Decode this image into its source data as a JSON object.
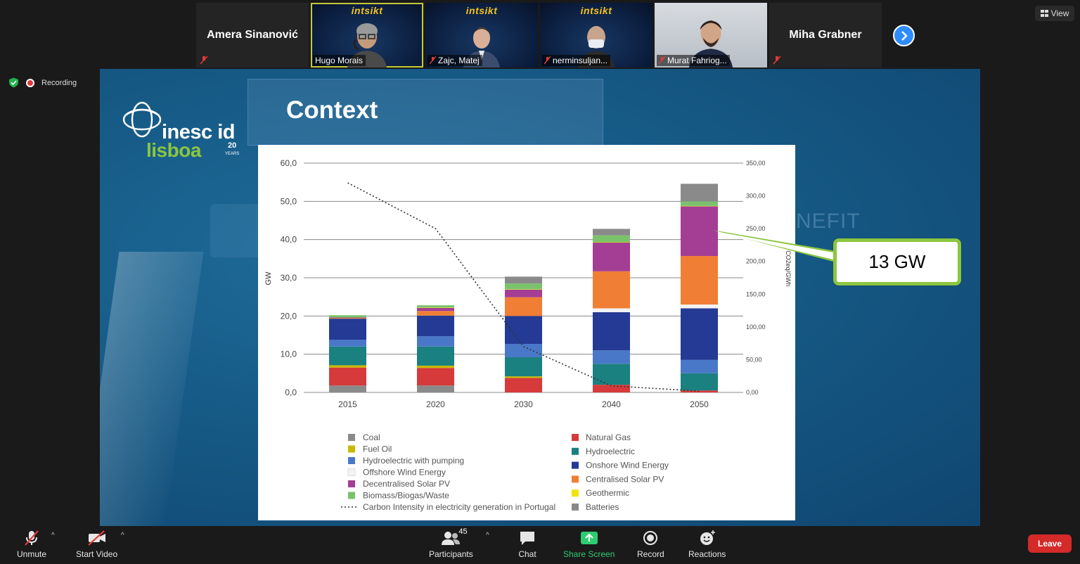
{
  "participants": [
    {
      "name": "Amera Sinanović",
      "video": false
    },
    {
      "name": "Hugo Morais",
      "video": true,
      "active": true
    },
    {
      "name": "Zajc, Matej",
      "video": true
    },
    {
      "name": "nerminsuljan...",
      "video": true
    },
    {
      "name": "Murat Fahriog...",
      "video": true
    },
    {
      "name": "Miha Grabner",
      "video": false
    }
  ],
  "video_watermark": "intsikt",
  "view_label": "View",
  "recording_label": "Recording",
  "slide": {
    "title": "Context",
    "logo": {
      "line1": "inesc id",
      "line2": "lisboa",
      "anniv": "20",
      "anniv_sub": "YEARS"
    },
    "watermark_right": "NEFIT",
    "callout": "13 GW"
  },
  "chart_data": {
    "type": "bar",
    "stacked": true,
    "categories": [
      "2015",
      "2020",
      "2030",
      "2040",
      "2050"
    ],
    "ylabel": "GW",
    "y2label": "T CO2eq/GWh",
    "ylim": [
      0,
      60
    ],
    "y2lim": [
      0,
      350
    ],
    "yticks": [
      "0,0",
      "10,0",
      "20,0",
      "30,0",
      "40,0",
      "50,0",
      "60,0"
    ],
    "y2ticks": [
      "0,00",
      "50,00",
      "100,00",
      "150,00",
      "200,00",
      "250,00",
      "300,00",
      "350,00"
    ],
    "grid": true,
    "series": [
      {
        "name": "Coal",
        "color": "#8a8a8a",
        "values": [
          1.8,
          1.8,
          0,
          0,
          0
        ]
      },
      {
        "name": "Natural Gas",
        "color": "#d63a3a",
        "values": [
          4.7,
          4.6,
          3.8,
          2.0,
          0.5
        ]
      },
      {
        "name": "Fuel Oil",
        "color": "#c9b800",
        "values": [
          0.6,
          0.6,
          0.4,
          0,
          0
        ]
      },
      {
        "name": "Hydroelectric",
        "color": "#1a8080",
        "values": [
          4.9,
          5.0,
          5.0,
          5.5,
          4.5
        ]
      },
      {
        "name": "Hydroelectric with pumping",
        "color": "#4a78c8",
        "values": [
          1.8,
          2.7,
          3.5,
          3.5,
          3.5
        ]
      },
      {
        "name": "Onshore Wind Energy",
        "color": "#243a94",
        "values": [
          5.5,
          5.4,
          7.3,
          10.0,
          13.5
        ]
      },
      {
        "name": "Offshore Wind Energy",
        "color": "#f3f3f3",
        "values": [
          0,
          0,
          0,
          1.0,
          1.0
        ]
      },
      {
        "name": "Centralised Solar PV",
        "color": "#f07e35",
        "values": [
          0.2,
          1.2,
          4.9,
          9.7,
          12.7
        ]
      },
      {
        "name": "Decentralised Solar PV",
        "color": "#a43d94",
        "values": [
          0.1,
          0.8,
          2.0,
          7.5,
          13.0
        ]
      },
      {
        "name": "Geothermic",
        "color": "#f2e400",
        "values": [
          0,
          0.1,
          0.1,
          0.1,
          0.1
        ]
      },
      {
        "name": "Biomass/Biogas/Waste",
        "color": "#7ac26b",
        "values": [
          0.6,
          0.6,
          1.5,
          1.8,
          1.2
        ]
      },
      {
        "name": "Batteries",
        "color": "#8a8a8a",
        "values": [
          0,
          0,
          1.8,
          1.7,
          4.6
        ]
      }
    ],
    "line": {
      "name": "Carbon Intensity in electricity generation in Portugal",
      "values": [
        320,
        250,
        70,
        10,
        2
      ]
    },
    "legend": {
      "left": [
        "Coal",
        "Fuel Oil",
        "Hydroelectric with pumping",
        "Offshore Wind Energy",
        "Decentralised Solar PV",
        "Biomass/Biogas/Waste",
        "Carbon Intensity in electricity generation in Portugal"
      ],
      "right": [
        "Natural Gas",
        "Hydroelectric",
        "Onshore Wind Energy",
        "Centralised Solar PV",
        "Geothermic",
        "Batteries"
      ]
    }
  },
  "toolbar": {
    "unmute": "Unmute",
    "start_video": "Start Video",
    "participants": "Participants",
    "participant_count": "45",
    "chat": "Chat",
    "share": "Share Screen",
    "record": "Record",
    "reactions": "Reactions",
    "leave": "Leave"
  },
  "colors": {
    "accent": "#2d8cff",
    "share": "#2ecc71",
    "leave": "#d42a2a",
    "callout_border": "#8cc63f"
  }
}
